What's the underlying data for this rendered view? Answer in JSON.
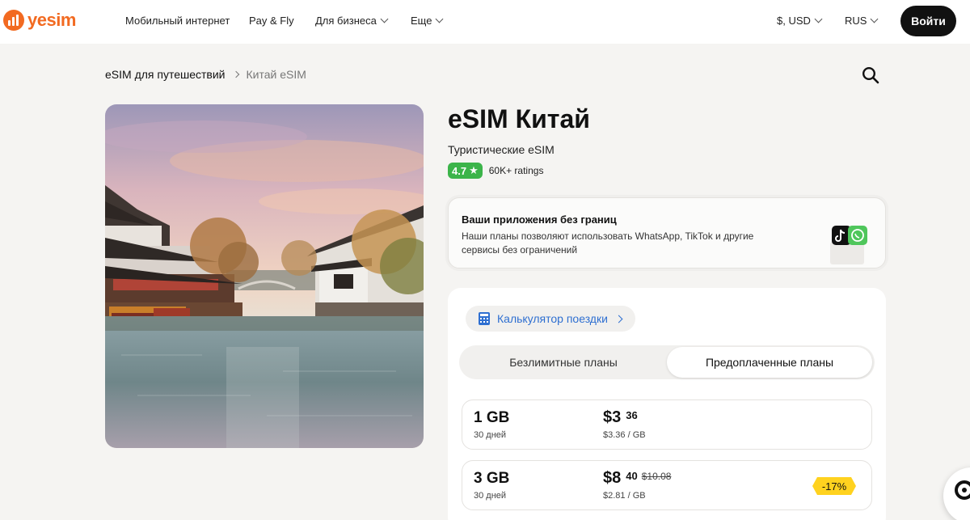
{
  "header": {
    "logo_text": "yesim",
    "nav": [
      {
        "label": "Мобильный интернет"
      },
      {
        "label": "Pay & Fly"
      },
      {
        "label": "Для бизнеса"
      },
      {
        "label": "Еще"
      }
    ],
    "currency": "$, USD",
    "language": "RUS",
    "login_label": "Войти"
  },
  "breadcrumb": {
    "root": "eSIM для путешествий",
    "current": "Китай eSIM"
  },
  "product": {
    "title": "eSIM Китай",
    "subtitle": "Туристические eSIM",
    "rating": "4.7",
    "ratings_count": "60K+ ratings"
  },
  "apps_card": {
    "title": "Ваши приложения без границ",
    "description": "Наши планы позволяют использовать WhatsApp, TikTok и другие сервисы без ограничений"
  },
  "calculator": {
    "label": "Калькулятор поездки"
  },
  "tabs": [
    {
      "label": "Безлимитные планы",
      "active": false
    },
    {
      "label": "Предоплаченные планы",
      "active": true
    }
  ],
  "plans": [
    {
      "amount": "1 GB",
      "days": "30 дней",
      "price_major": "$3",
      "price_minor": "36",
      "old_price": "",
      "per_gb": "$3.36 / GB",
      "discount": ""
    },
    {
      "amount": "3 GB",
      "days": "30 дней",
      "price_major": "$8",
      "price_minor": "40",
      "old_price": "$10.08",
      "per_gb": "$2.81 / GB",
      "discount": "-17%"
    }
  ],
  "colors": {
    "brand": "#f26a21",
    "rating_green": "#3cb44a",
    "link_blue": "#2e6fd1",
    "discount_yellow": "#ffd21f"
  }
}
